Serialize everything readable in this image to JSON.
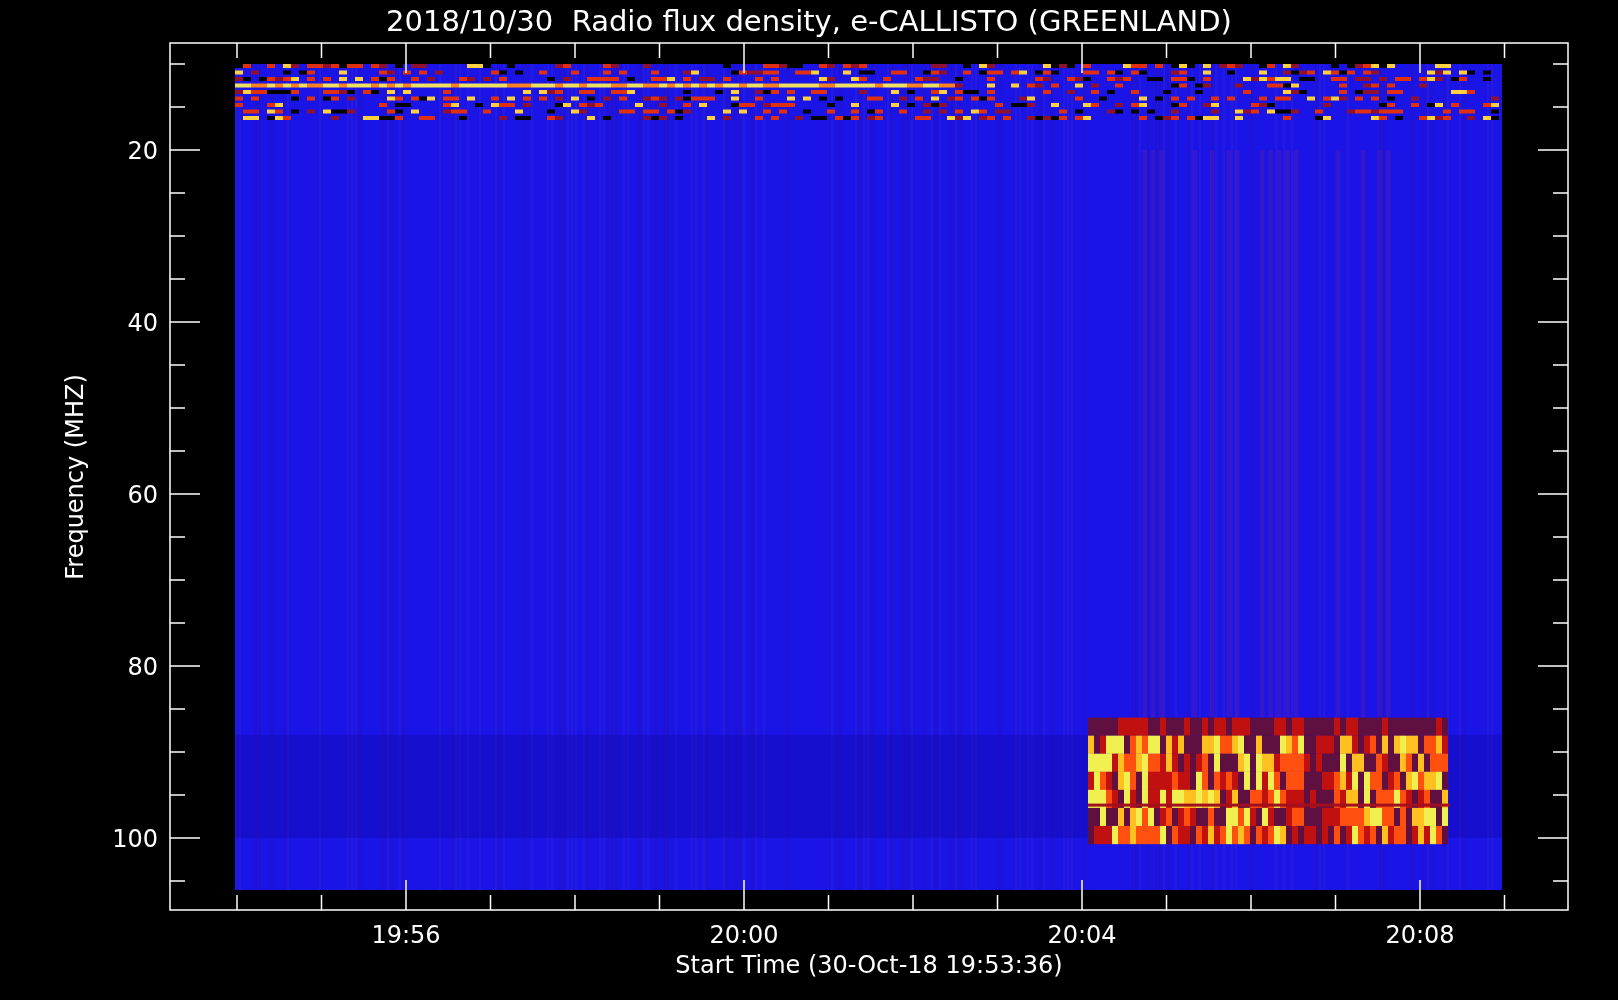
{
  "plot": {
    "title": "2018/10/30  Radio flux density, e-CALLISTO (GREENLAND)",
    "ylabel": "Frequency (MHZ)",
    "xlabel": "Start Time (30-Oct-18 19:53:36)",
    "yticks": [
      "20",
      "40",
      "60",
      "80",
      "100"
    ],
    "xticks": [
      "19:56",
      "20:00",
      "20:04",
      "20:08"
    ]
  }
}
